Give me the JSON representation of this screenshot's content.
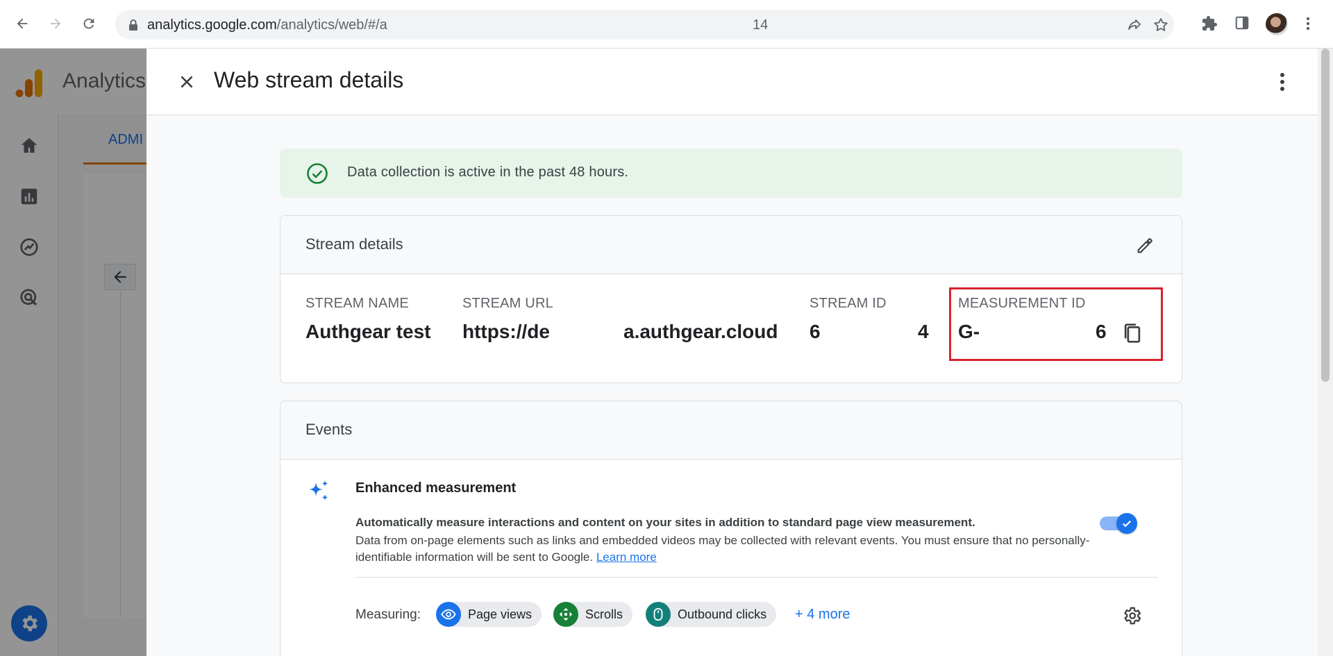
{
  "browser": {
    "url_host": "analytics.google.com",
    "url_path": "/analytics/web/#/a",
    "url_end": "14"
  },
  "ga": {
    "app_title": "Analytics",
    "tab_label": "ADMI"
  },
  "drawer": {
    "title": "Web stream details",
    "banner_text": "Data collection is active in the past 48 hours.",
    "stream_details": {
      "heading": "Stream details",
      "fields": {
        "stream_name": {
          "label": "STREAM NAME",
          "value": "Authgear test"
        },
        "stream_url": {
          "label": "STREAM URL",
          "value_start": "https://de",
          "value_end": "a.authgear.cloud"
        },
        "stream_id": {
          "label": "STREAM ID",
          "value_start": "6",
          "value_end": "4"
        },
        "measurement_id": {
          "label": "MEASUREMENT ID",
          "value_start": "G-",
          "value_end": "6"
        }
      }
    },
    "events": {
      "heading": "Events",
      "enhanced_measurement": {
        "title": "Enhanced measurement",
        "desc_bold": "Automatically measure interactions and content on your sites in addition to standard page view measurement.",
        "desc": "Data from on-page elements such as links and embedded videos may be collected with relevant events. You must ensure that no personally-identifiable information will be sent to Google.",
        "learn_more": "Learn more",
        "enabled": true
      },
      "measuring_label": "Measuring:",
      "chips": [
        {
          "label": "Page views",
          "icon": "eye-icon",
          "color": "#1a73e8"
        },
        {
          "label": "Scrolls",
          "icon": "scroll-icon",
          "color": "#188038"
        },
        {
          "label": "Outbound clicks",
          "icon": "mouse-icon",
          "color": "#12807a"
        }
      ],
      "more_link": "+ 4 more"
    }
  },
  "colors": {
    "accent": "#1a73e8",
    "success_bg": "#e6f4ea",
    "success": "#188038",
    "highlight": "#d9232f"
  }
}
